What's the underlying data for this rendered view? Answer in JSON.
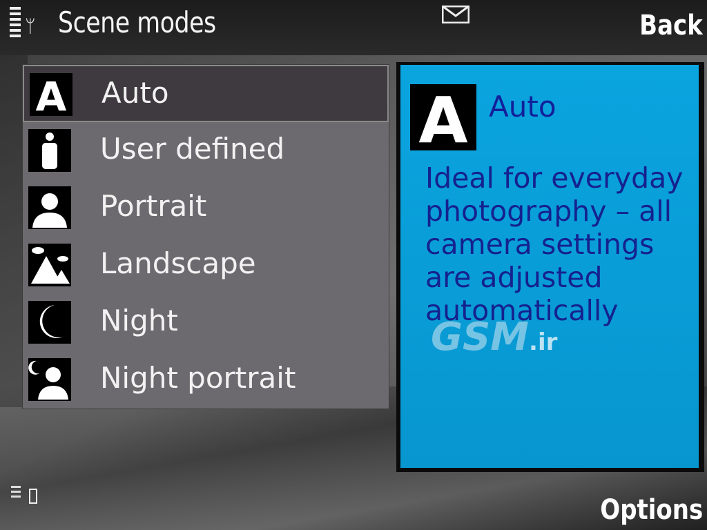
{
  "status_bar": {
    "title": "Scene modes",
    "back_label": "Back",
    "icons": [
      "signal-strength-icon",
      "antenna-icon",
      "mail-icon"
    ]
  },
  "scene_list": {
    "items": [
      {
        "label": "Auto",
        "icon": "auto-icon",
        "selected": true
      },
      {
        "label": "User defined",
        "icon": "user-defined-icon",
        "selected": false
      },
      {
        "label": "Portrait",
        "icon": "portrait-icon",
        "selected": false
      },
      {
        "label": "Landscape",
        "icon": "landscape-icon",
        "selected": false
      },
      {
        "label": "Night",
        "icon": "night-icon",
        "selected": false
      },
      {
        "label": "Night portrait",
        "icon": "night-portrait-icon",
        "selected": false
      }
    ]
  },
  "detail": {
    "title": "Auto",
    "icon": "auto-icon",
    "description": "Ideal for everyday photography – all camera settings are adjusted automatically"
  },
  "watermark": {
    "text": "GSM",
    "suffix": ".ir"
  },
  "softkeys": {
    "right": "Back",
    "left_bottom": "Options"
  },
  "colors": {
    "panel": "#0aa4df",
    "panel_text": "#15218f",
    "list_bg": "#6d6a6f",
    "selected_bg": "#3e3a3f"
  }
}
